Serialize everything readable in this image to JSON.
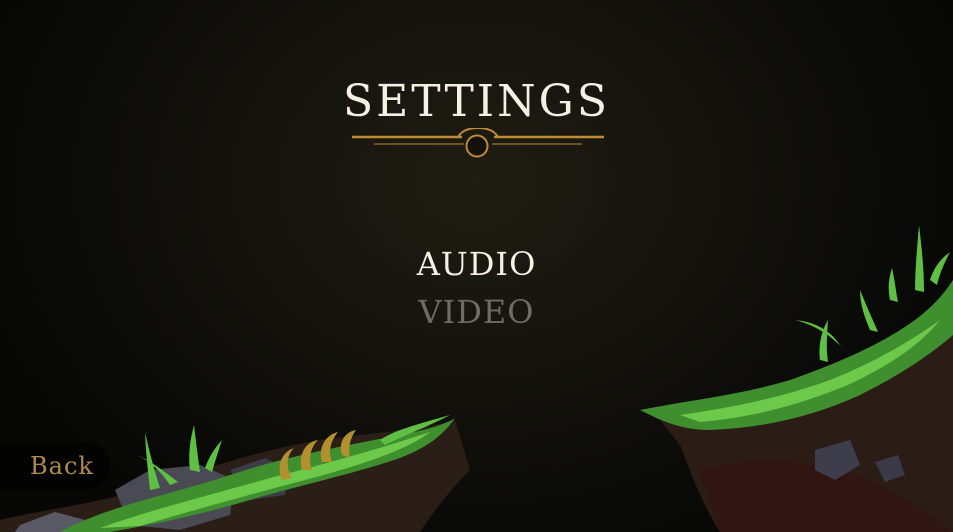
{
  "settings": {
    "title": "SETTINGS",
    "accent_color": "#c08a34",
    "menu": [
      {
        "label": "AUDIO",
        "state": "selected"
      },
      {
        "label": "VIDEO",
        "state": "unselected"
      }
    ],
    "back_label": "Back"
  }
}
